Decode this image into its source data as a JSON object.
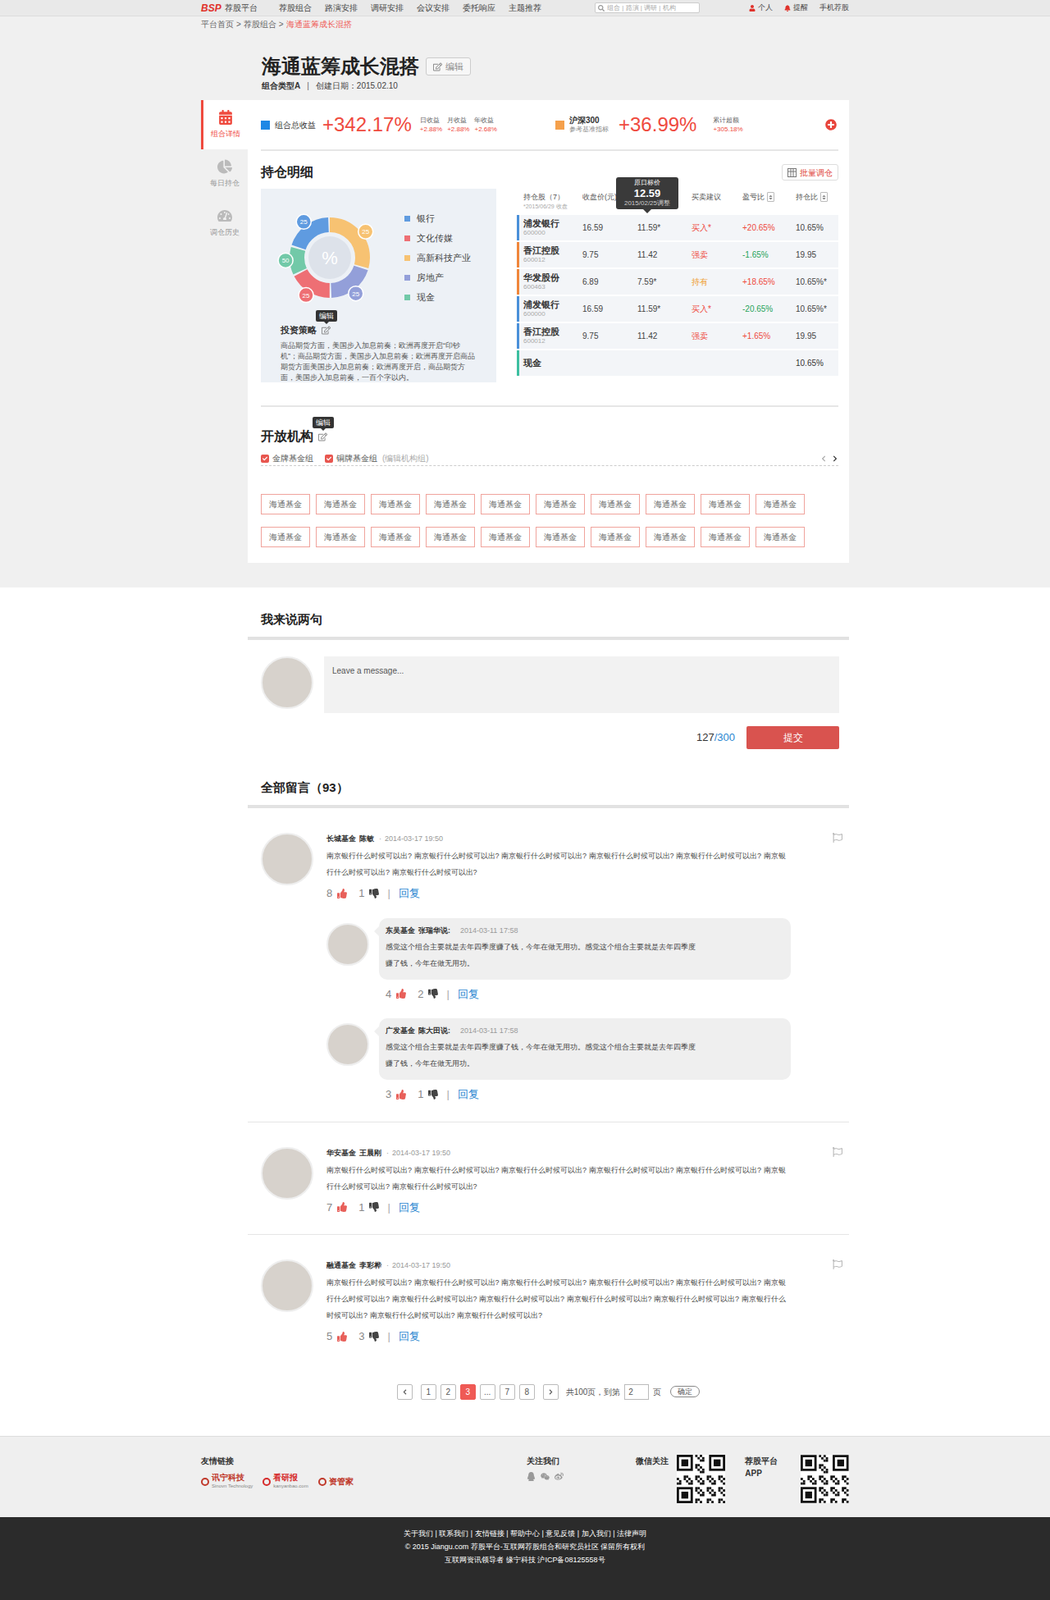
{
  "nav": {
    "logo": "BSP",
    "platform": "荐股平台",
    "menu": [
      "荐股组合",
      "路演安排",
      "调研安排",
      "会议安排",
      "委托响应",
      "主题推荐"
    ],
    "search_placeholder": "组合 | 路演 | 调研 | 机构",
    "right": [
      {
        "label": "个人",
        "kind": "user"
      },
      {
        "label": "提醒",
        "kind": "bell"
      },
      {
        "label": "手机荐股",
        "kind": "plain"
      }
    ]
  },
  "breadcrumb": [
    {
      "label": "平台首页",
      "current": false
    },
    {
      "label": ">",
      "current": false,
      "kind": "sep"
    },
    {
      "label": "荐股组合",
      "current": false
    },
    {
      "label": ">",
      "current": false,
      "kind": "sep"
    },
    {
      "label": "海通蓝筹成长混搭",
      "current": true
    }
  ],
  "portfolio": {
    "title": "海通蓝筹成长混搭",
    "edit": "编辑",
    "type": "组合类型A",
    "separator": "|",
    "created": "创建日期：2015.02.10"
  },
  "sidebar": [
    {
      "label": "组合详情",
      "selected": true
    },
    {
      "label": "每日持仓",
      "selected": false
    },
    {
      "label": "调仓历史",
      "selected": false
    }
  ],
  "summary": {
    "total": {
      "label": "组合总收益",
      "value": "+342.17%"
    },
    "stats": [
      {
        "label": "日收益",
        "value": "+2.88%"
      },
      {
        "label": "月收益",
        "value": "+2.88%"
      },
      {
        "label": "年收益",
        "value": "+2.68%"
      }
    ],
    "benchmark": {
      "name": "沪深300",
      "sub": "参考基准指标",
      "value": "+36.99%"
    },
    "excess": {
      "label": "累计超额",
      "value": "+305.18%"
    }
  },
  "holdings": {
    "title": "持仓明细",
    "batch": "批量调仓",
    "chart": {
      "center": "%",
      "segments": [
        {
          "badge": "25",
          "share": 0.3,
          "color": "#f7c272"
        },
        {
          "badge": "25",
          "share": 0.2,
          "color": "#939fd9"
        },
        {
          "badge": "25",
          "share": 0.18,
          "color": "#ee6f74"
        },
        {
          "badge": "50",
          "share": 0.12,
          "color": "#72c9a8"
        },
        {
          "badge": "25",
          "share": 0.2,
          "color": "#5f9be0"
        }
      ],
      "legend": [
        {
          "label": "银行",
          "color": "#5f9be0"
        },
        {
          "label": "文化传媒",
          "color": "#ee6f74"
        },
        {
          "label": "高新科技产业",
          "color": "#f7c272"
        },
        {
          "label": "房地产",
          "color": "#939fd9"
        },
        {
          "label": "现金",
          "color": "#72c9a8"
        }
      ]
    },
    "strategy": {
      "title": "投资策略",
      "edit_tip": "编辑",
      "text": "商品期货方面，美国步入加息前奏；欧洲再度开启“印钞机”；商品期货方面，美国步入加息前奏；欧洲再度开启商品期货方面美国步入加息前奏；欧洲再度开启，商品期货方面，美国步入加息前奏，一百个字以内。"
    },
    "columns": [
      {
        "label": "持仓股（7）",
        "sub": "*2015/06/29 收盘",
        "sortable": false,
        "kind": "text"
      },
      {
        "label": "收盘价(元)",
        "sub": "",
        "sortable": false,
        "kind": "text"
      },
      {
        "label": "",
        "sub": "",
        "sortable": false,
        "kind": "tooltip"
      },
      {
        "label": "买卖建议",
        "sub": "",
        "sortable": false,
        "kind": "text"
      },
      {
        "label": "盈亏比",
        "sub": "",
        "sortable": true,
        "kind": "text"
      },
      {
        "label": "持仓比",
        "sub": "",
        "sortable": true,
        "kind": "text"
      }
    ],
    "tooltip": {
      "title": "原日标价",
      "value": "12.59",
      "date": "2015/02/25调整"
    },
    "rows": [
      {
        "name": "浦发银行",
        "code": "600000",
        "close": "16.59",
        "price": "11.59*",
        "advice": "买入*",
        "advice_kind": "buy",
        "pl": "+20.65%",
        "trend": "up",
        "position": "10.65%",
        "color": "#4a90d9"
      },
      {
        "name": "香江控股",
        "code": "600012",
        "close": "9.75",
        "price": "11.42",
        "advice": "强卖",
        "advice_kind": "sell",
        "pl": "-1.65%",
        "trend": "down",
        "position": "19.95",
        "color": "#f0863a"
      },
      {
        "name": "华发股份",
        "code": "600463",
        "close": "6.89",
        "price": "7.59*",
        "advice": "持有",
        "advice_kind": "hold",
        "pl": "+18.65%",
        "trend": "up",
        "position": "10.65%*",
        "color": "#f0863a"
      },
      {
        "name": "浦发银行",
        "code": "600000",
        "close": "16.59",
        "price": "11.59*",
        "advice": "买入*",
        "advice_kind": "buy",
        "pl": "-20.65%",
        "trend": "down",
        "position": "10.65%*",
        "color": "#4a90d9"
      },
      {
        "name": "香江控股",
        "code": "600012",
        "close": "9.75",
        "price": "11.42",
        "advice": "强卖",
        "advice_kind": "sell",
        "pl": "+1.65%",
        "trend": "up",
        "position": "19.95",
        "color": "#4a90d9"
      }
    ],
    "cash": {
      "name": "现金",
      "position": "10.65%",
      "color": "#3cbfa0"
    }
  },
  "institutions": {
    "title": "开放机构",
    "edit_tip": "编辑",
    "groups": [
      {
        "label": "金牌基金组",
        "checked": true
      },
      {
        "label": "铜牌基金组",
        "checked": true
      }
    ],
    "edit_groups": "(编辑机构组)",
    "tags": [
      "海通基金",
      "海通基金",
      "海通基金",
      "海通基金",
      "海通基金",
      "海通基金",
      "海通基金",
      "海通基金",
      "海通基金",
      "海通基金",
      "海通基金",
      "海通基金",
      "海通基金",
      "海通基金",
      "海通基金",
      "海通基金",
      "海通基金",
      "海通基金",
      "海通基金",
      "海通基金"
    ]
  },
  "compose": {
    "title": "我来说两句",
    "placeholder": "Leave a message...",
    "count": "127",
    "limit": "/300",
    "submit": "提交"
  },
  "comments_title": "全部留言（93）",
  "divider": "|",
  "reply_label": "回复",
  "dot": "·",
  "comments": [
    {
      "org": "长城基金",
      "name": "陈敏",
      "time": "2014-03-17 19:50",
      "text": "南京银行什么时候可以出? 南京银行什么时候可以出? 南京银行什么时候可以出? 南京银行什么时候可以出? 南京银行什么时候可以出? 南京银行什么时候可以出? 南京银行什么时候可以出?",
      "up": "8",
      "down": "1",
      "replies": [
        {
          "org": "东吴基金",
          "name": "张瑞华说:",
          "time": "2014-03-11 17:58",
          "text": "感觉这个组合主要就是去年四季度赚了钱，今年在做无用功。感觉这个组合主要就是去年四季度赚了钱，今年在做无用功。",
          "up": "4",
          "down": "2"
        },
        {
          "org": "广发基金",
          "name": "陈大田说:",
          "time": "2014-03-11 17:58",
          "text": "感觉这个组合主要就是去年四季度赚了钱，今年在做无用功。感觉这个组合主要就是去年四季度赚了钱，今年在做无用功。",
          "up": "3",
          "down": "1"
        }
      ]
    },
    {
      "org": "华安基金",
      "name": "王晨刚",
      "time": "2014-03-17 19:50",
      "text": "南京银行什么时候可以出? 南京银行什么时候可以出? 南京银行什么时候可以出? 南京银行什么时候可以出? 南京银行什么时候可以出? 南京银行什么时候可以出? 南京银行什么时候可以出?",
      "up": "7",
      "down": "1",
      "replies": []
    },
    {
      "org": "融通基金",
      "name": "李彩桦",
      "time": "2014-03-17 19:50",
      "text": "南京银行什么时候可以出? 南京银行什么时候可以出? 南京银行什么时候可以出? 南京银行什么时候可以出? 南京银行什么时候可以出? 南京银行什么时候可以出? 南京银行什么时候可以出? 南京银行什么时候可以出? 南京银行什么时候可以出? 南京银行什么时候可以出? 南京银行什么时候可以出? 南京银行什么时候可以出? 南京银行什么时候可以出?",
      "up": "5",
      "down": "3",
      "replies": []
    }
  ],
  "pagination": {
    "pages": [
      {
        "label": "1",
        "selected": false
      },
      {
        "label": "2",
        "selected": false
      },
      {
        "label": "3",
        "selected": true
      },
      {
        "label": "...",
        "selected": false
      },
      {
        "label": "7",
        "selected": false
      },
      {
        "label": "8",
        "selected": false
      }
    ],
    "total": "共100页，到第",
    "input": "2",
    "unit": "页",
    "go": "确定"
  },
  "footer": {
    "links_title": "友情链接",
    "links": [
      {
        "name": "讯宁科技",
        "sub": "Sinovn Technology",
        "color": "#c0392b"
      },
      {
        "name": "看研报",
        "sub": "kanyanbao.com",
        "color": "#d62b2b"
      },
      {
        "name": "资管家",
        "sub": "",
        "color": "#c0392b"
      }
    ],
    "follow": "关注我们",
    "wechat": "微信关注",
    "app": "荐股平台APP",
    "bottom_links": "关于我们 | 联系我们 | 友情链接 | 帮助中心 | 意见反馈 | 加入我们 | 法律声明",
    "copyright": "© 2015 Jiangu.com 荐股平台-互联网荐股组合和研究员社区 保留所有权利",
    "icp": "互联网资讯领导者 缘宁科技 沪ICP备08125558号"
  }
}
